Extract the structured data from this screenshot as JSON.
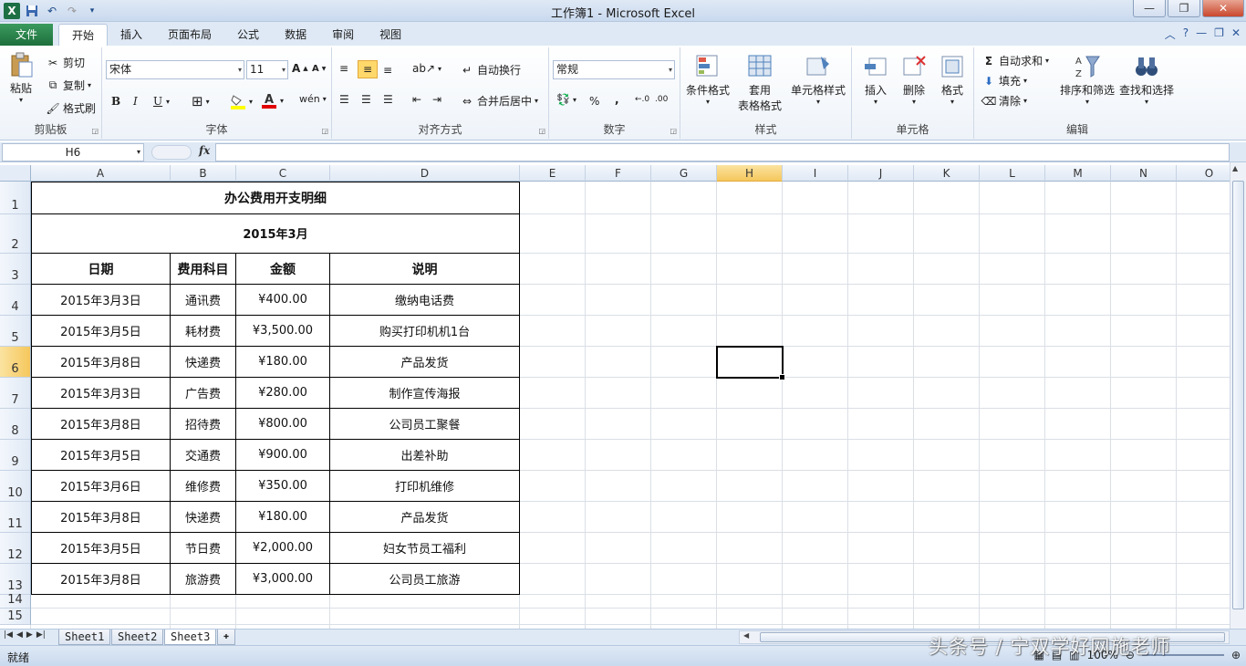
{
  "window": {
    "title": "工作簿1 - Microsoft Excel"
  },
  "tabs": [
    "文件",
    "开始",
    "插入",
    "页面布局",
    "公式",
    "数据",
    "审阅",
    "视图"
  ],
  "ribbon": {
    "clipboard": {
      "label": "剪贴板",
      "paste": "粘贴",
      "cut": "剪切",
      "copy": "复制",
      "format_painter": "格式刷"
    },
    "font": {
      "label": "字体",
      "name": "宋体",
      "size": "11",
      "bold": "B",
      "italic": "I",
      "underline": "U"
    },
    "alignment": {
      "label": "对齐方式",
      "wrap": "自动换行",
      "merge": "合并后居中"
    },
    "number": {
      "label": "数字",
      "format": "常规",
      "percent": "%",
      "comma": ","
    },
    "styles": {
      "label": "样式",
      "conditional": "条件格式",
      "table_line1": "套用",
      "table_line2": "表格格式",
      "cell_styles": "单元格样式"
    },
    "cells": {
      "label": "单元格",
      "insert": "插入",
      "delete": "删除",
      "format": "格式"
    },
    "editing": {
      "label": "编辑",
      "autosum": "自动求和",
      "fill": "填充",
      "clear": "清除",
      "sort": "排序和筛选",
      "find": "查找和选择"
    }
  },
  "formula_bar": {
    "name_box": "H6",
    "fx": "fx",
    "value": ""
  },
  "columns": [
    "A",
    "B",
    "C",
    "D",
    "E",
    "F",
    "G",
    "H",
    "I",
    "J",
    "K",
    "L",
    "M",
    "N",
    "O"
  ],
  "rows": [
    "1",
    "2",
    "3",
    "4",
    "5",
    "6",
    "7",
    "8",
    "9",
    "10",
    "11",
    "12",
    "13",
    "14",
    "15"
  ],
  "sheet": {
    "title": "办公费用开支明细",
    "subtitle": "2015年3月",
    "headers": [
      "日期",
      "费用科目",
      "金额",
      "说明"
    ],
    "records": [
      [
        "2015年3月3日",
        "通讯费",
        "¥400.00",
        "缴纳电话费"
      ],
      [
        "2015年3月5日",
        "耗材费",
        "¥3,500.00",
        "购买打印机机1台"
      ],
      [
        "2015年3月8日",
        "快递费",
        "¥180.00",
        "产品发货"
      ],
      [
        "2015年3月3日",
        "广告费",
        "¥280.00",
        "制作宣传海报"
      ],
      [
        "2015年3月8日",
        "招待费",
        "¥800.00",
        "公司员工聚餐"
      ],
      [
        "2015年3月5日",
        "交通费",
        "¥900.00",
        "出差补助"
      ],
      [
        "2015年3月6日",
        "维修费",
        "¥350.00",
        "打印机维修"
      ],
      [
        "2015年3月8日",
        "快递费",
        "¥180.00",
        "产品发货"
      ],
      [
        "2015年3月5日",
        "节日费",
        "¥2,000.00",
        "妇女节员工福利"
      ],
      [
        "2015年3月8日",
        "旅游费",
        "¥3,000.00",
        "公司员工旅游"
      ]
    ]
  },
  "sheet_tabs": [
    "Sheet1",
    "Sheet2",
    "Sheet3"
  ],
  "status": {
    "ready": "就绪",
    "zoom": "100%"
  },
  "watermark": "头条号 / 宁双学好网施老师"
}
